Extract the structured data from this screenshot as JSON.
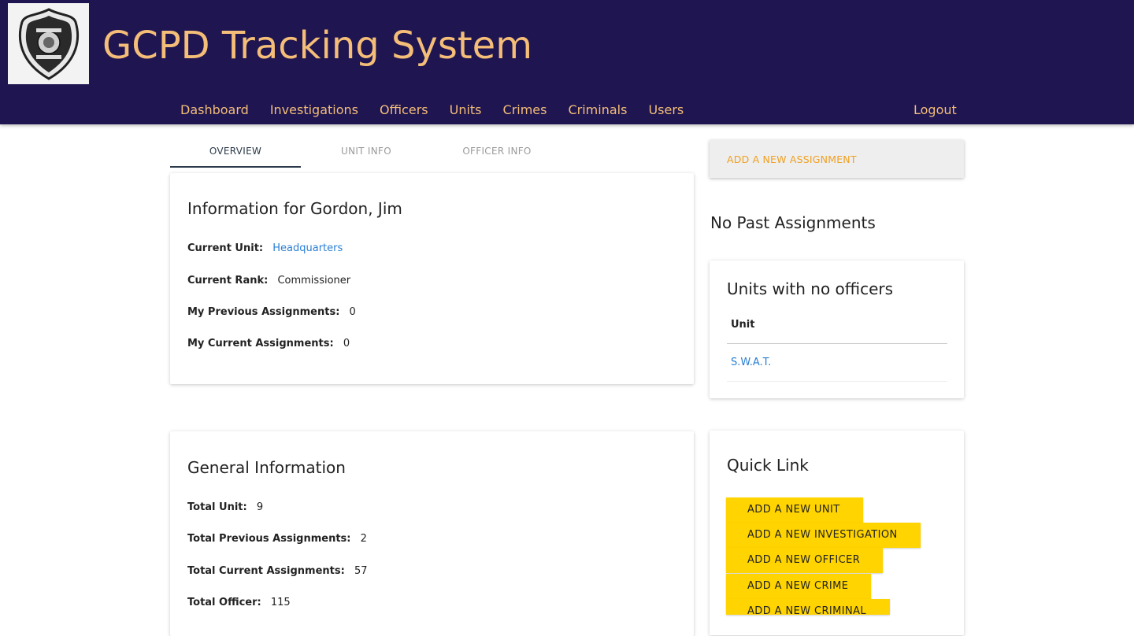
{
  "header": {
    "title": "GCPD Tracking System",
    "logo_icon": "police-badge-icon",
    "nav": [
      "Dashboard",
      "Investigations",
      "Officers",
      "Units",
      "Crimes",
      "Criminals",
      "Users"
    ],
    "logout": "Logout",
    "colors": {
      "background": "#1e1551",
      "text": "#f4bd78"
    }
  },
  "tabs": [
    "OVERVIEW",
    "UNIT INFO",
    "OFFICER INFO"
  ],
  "info_card": {
    "title": "Information for Gordon, Jim",
    "current_unit_label": "Current Unit:",
    "current_unit_value": "Headquarters",
    "current_rank_label": "Current Rank:",
    "current_rank_value": "Commissioner",
    "prev_assign_label": "My Previous Assignments:",
    "prev_assign_value": "0",
    "curr_assign_label": "My Current Assignments:",
    "curr_assign_value": "0"
  },
  "general_card": {
    "title": "General Information",
    "total_unit_label": "Total Unit:",
    "total_unit_value": "9",
    "total_prev_label": "Total Previous Assignments:",
    "total_prev_value": "2",
    "total_curr_label": "Total Current Assignments:",
    "total_curr_value": "57",
    "total_officer_label": "Total Officer:",
    "total_officer_value": "115"
  },
  "assignment": {
    "add_button": "ADD A NEW ASSIGNMENT",
    "no_past": "No Past Assignments"
  },
  "units_card": {
    "title": "Units with no officers",
    "column": "Unit",
    "rows": [
      "S.W.A.T."
    ]
  },
  "quick_link": {
    "title": "Quick Link",
    "buttons": [
      "ADD A NEW UNIT",
      "ADD A NEW INVESTIGATION",
      "ADD A NEW OFFICER",
      "ADD A NEW CRIME",
      "ADD A NEW CRIMINAL"
    ]
  }
}
